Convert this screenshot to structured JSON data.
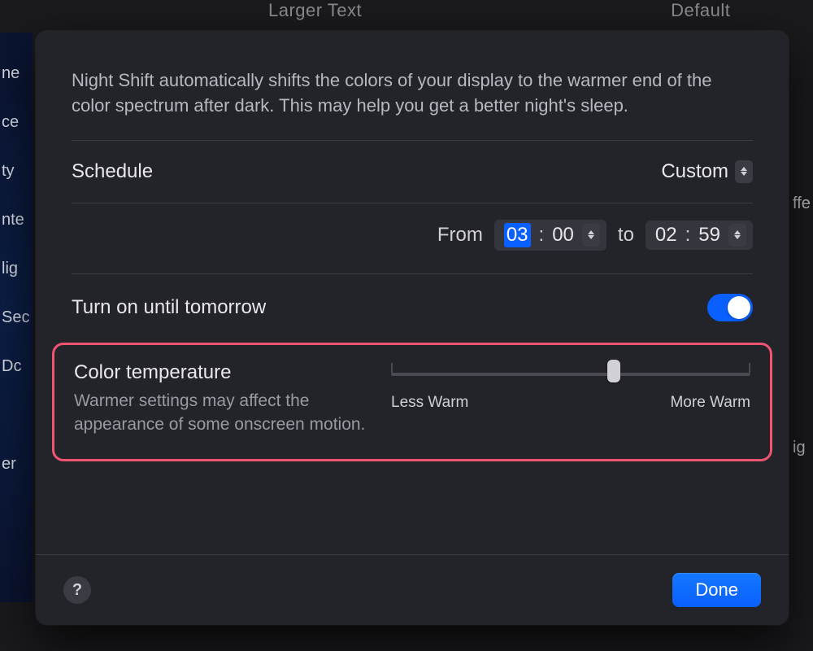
{
  "backdrop": {
    "top_left": "Larger Text",
    "top_right": "Default",
    "sidebar": [
      "ne",
      "ce",
      "ty",
      "nte",
      "lig",
      "Sec",
      "Dc",
      "",
      "er"
    ],
    "right": [
      "",
      "",
      "ffe",
      "",
      "",
      "",
      "",
      "ig"
    ]
  },
  "sheet": {
    "description": "Night Shift automatically shifts the colors of your display to the warmer end of the color spectrum after dark. This may help you get a better night's sleep.",
    "schedule": {
      "label": "Schedule",
      "value": "Custom",
      "from_label": "From",
      "from_hour": "03",
      "from_minute": "00",
      "to_label": "to",
      "to_hour": "02",
      "to_minute": "59"
    },
    "turn_on": {
      "label": "Turn on until tomorrow",
      "value": true
    },
    "color_temp": {
      "title": "Color temperature",
      "subtitle": "Warmer settings may affect the appearance of some onscreen motion.",
      "min_label": "Less Warm",
      "max_label": "More Warm",
      "value_percent": 62
    },
    "footer": {
      "help": "?",
      "done": "Done"
    }
  }
}
